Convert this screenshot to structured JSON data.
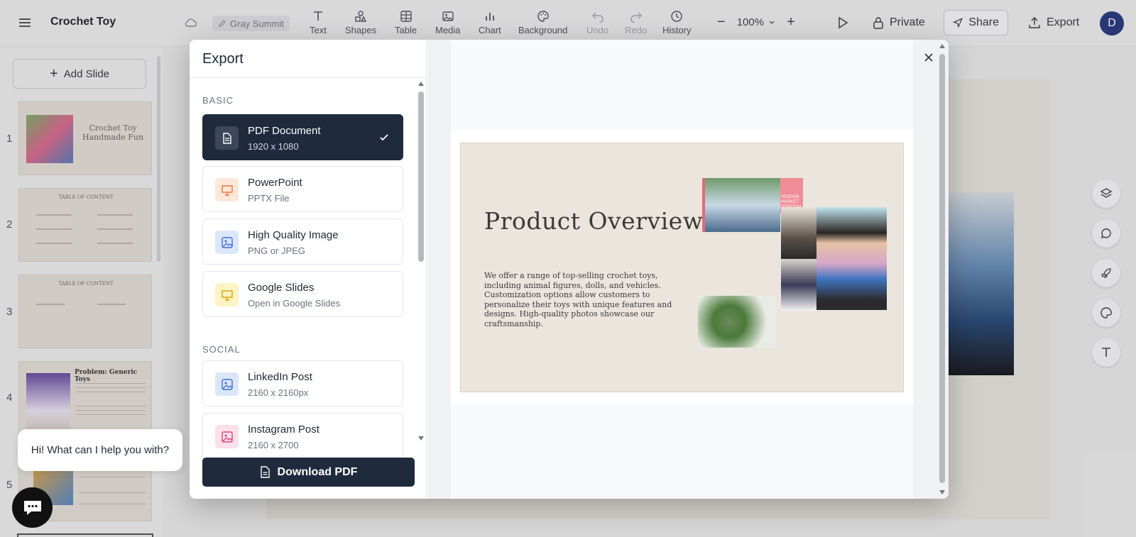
{
  "app": {
    "title": "Crochet Toy",
    "workspace_chip": "Gray Summit"
  },
  "toolbar": {
    "tools": [
      {
        "label": "Text",
        "icon": "text-icon",
        "enabled": true
      },
      {
        "label": "Shapes",
        "icon": "shapes-icon",
        "enabled": true
      },
      {
        "label": "Table",
        "icon": "table-icon",
        "enabled": true
      },
      {
        "label": "Media",
        "icon": "media-icon",
        "enabled": true
      },
      {
        "label": "Chart",
        "icon": "chart-icon",
        "enabled": true
      },
      {
        "label": "Background",
        "icon": "palette-icon",
        "enabled": true
      },
      {
        "label": "Undo",
        "icon": "undo-icon",
        "enabled": false
      },
      {
        "label": "Redo",
        "icon": "redo-icon",
        "enabled": false
      },
      {
        "label": "History",
        "icon": "clock-icon",
        "enabled": true
      }
    ],
    "zoom": "100%",
    "private_label": "Private",
    "share_label": "Share",
    "export_label": "Export",
    "avatar_initial": "D"
  },
  "sidebar": {
    "add_slide_label": "Add Slide",
    "slides": [
      {
        "number": "1",
        "title": "Crochet Toy\nHandmade Fun"
      },
      {
        "number": "2",
        "title": "TABLE OF CONTENT"
      },
      {
        "number": "3",
        "title": "TABLE OF CONTENT"
      },
      {
        "number": "4",
        "title": "Problem: Generic Toys"
      },
      {
        "number": "5",
        "title": ""
      }
    ]
  },
  "export_modal": {
    "title": "Export",
    "sections": [
      {
        "label": "BASIC",
        "options": [
          {
            "title": "PDF Document",
            "subtitle": "1920 x 1080",
            "icon": "document-icon",
            "selected": true
          },
          {
            "title": "PowerPoint",
            "subtitle": "PPTX File",
            "icon": "presentation-icon",
            "selected": false
          },
          {
            "title": "High Quality Image",
            "subtitle": "PNG or JPEG",
            "icon": "image-icon",
            "selected": false
          },
          {
            "title": "Google Slides",
            "subtitle": "Open in Google Slides",
            "icon": "presentation-icon",
            "selected": false
          }
        ]
      },
      {
        "label": "SOCIAL",
        "options": [
          {
            "title": "LinkedIn Post",
            "subtitle": "2160 x 2160px",
            "icon": "image-icon",
            "selected": false
          },
          {
            "title": "Instagram Post",
            "subtitle": "2160 x 2700",
            "icon": "image-icon",
            "selected": false
          }
        ]
      }
    ],
    "download_label": "Download PDF",
    "preview": {
      "slide_title": "Product Overview",
      "slide_body": "We offer a range of top-selling crochet toys, including animal figures, dolls, and vehicles. Customization options allow customers to personalize their toys with unique features and designs. High-quality photos showcase our craftsmanship.",
      "sticker_text": "VENDOR MARKET DISPOSALS & SETUP"
    }
  },
  "chat": {
    "greeting": "Hi! What can I help you with?"
  },
  "colors": {
    "selected_option": "#1f2a3d",
    "powerpoint_icon_bg": "#fde7d9",
    "image_icon_bg": "#dbe6fb",
    "slides_icon_bg": "#fdf3c4",
    "instagram_icon_bg": "#fde0ea"
  }
}
